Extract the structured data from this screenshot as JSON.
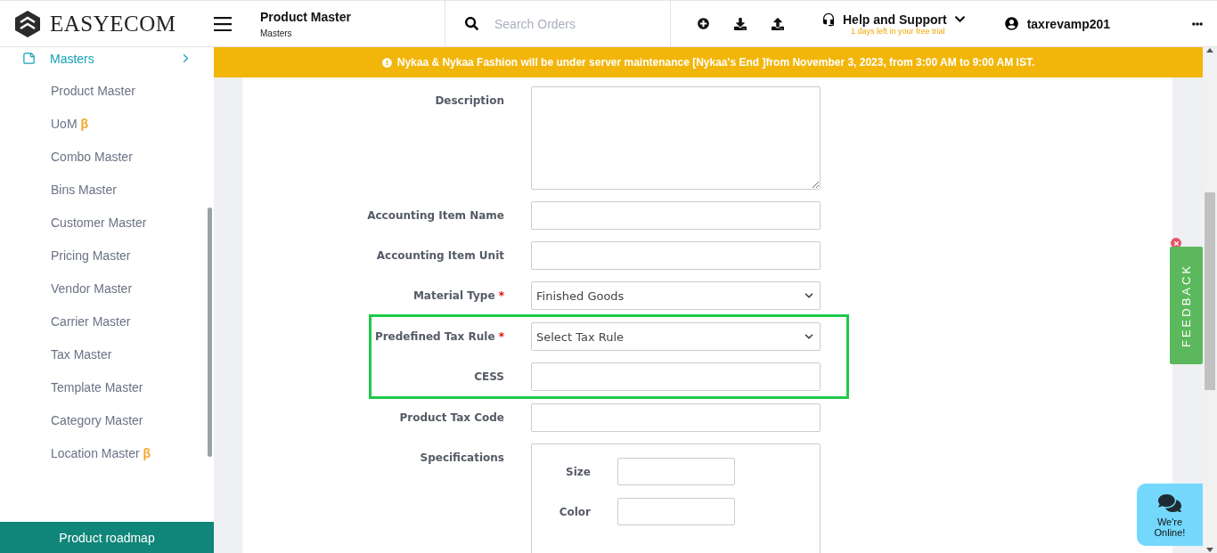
{
  "header": {
    "brand": "EASYECOM",
    "page_title": "Product Master",
    "breadcrumb": "Masters",
    "search": {
      "placeholder": "Search Orders"
    },
    "help": {
      "label": "Help and Support",
      "trial_note": "1 days left in your free trial"
    },
    "user": {
      "name": "taxrevamp201"
    }
  },
  "sidebar": {
    "section": {
      "label": "Masters"
    },
    "items": [
      {
        "label": "Product Master"
      },
      {
        "label": "UoM",
        "badge": "β"
      },
      {
        "label": "Combo Master"
      },
      {
        "label": "Bins Master"
      },
      {
        "label": "Customer Master"
      },
      {
        "label": "Pricing Master"
      },
      {
        "label": "Vendor Master"
      },
      {
        "label": "Carrier Master"
      },
      {
        "label": "Tax Master"
      },
      {
        "label": "Template Master"
      },
      {
        "label": "Category Master"
      },
      {
        "label": "Location Master",
        "badge": "β"
      }
    ],
    "footer_button": "Product roadmap"
  },
  "banner": "Nykaa & Nykaa Fashion will be under server maintenance [Nykaa's End ]from November 3, 2023, from 3:00 AM to 9:00 AM IST.",
  "form": {
    "sections": [
      {
        "highlighted": false,
        "fields": [
          {
            "kind": "textarea",
            "label": "Description"
          },
          {
            "kind": "input",
            "label": "Accounting Item Name"
          },
          {
            "kind": "input",
            "label": "Accounting Item Unit"
          },
          {
            "kind": "select",
            "label": "Material Type",
            "required_mark": "*",
            "value": "Finished Goods"
          }
        ]
      },
      {
        "highlighted": true,
        "fields": [
          {
            "kind": "select",
            "label": "Predefined Tax Rule",
            "required_mark": "*",
            "value": "Select Tax Rule"
          },
          {
            "kind": "input",
            "label": "CESS"
          }
        ]
      },
      {
        "highlighted": false,
        "fields": [
          {
            "kind": "input",
            "label": "Product Tax Code"
          },
          {
            "kind": "group",
            "label": "Specifications",
            "subfields": [
              {
                "label": "Size"
              },
              {
                "label": "Color"
              }
            ]
          }
        ]
      }
    ]
  },
  "feedback": {
    "label": "FEEDBACK"
  },
  "chat": {
    "label": "We're Online!"
  }
}
